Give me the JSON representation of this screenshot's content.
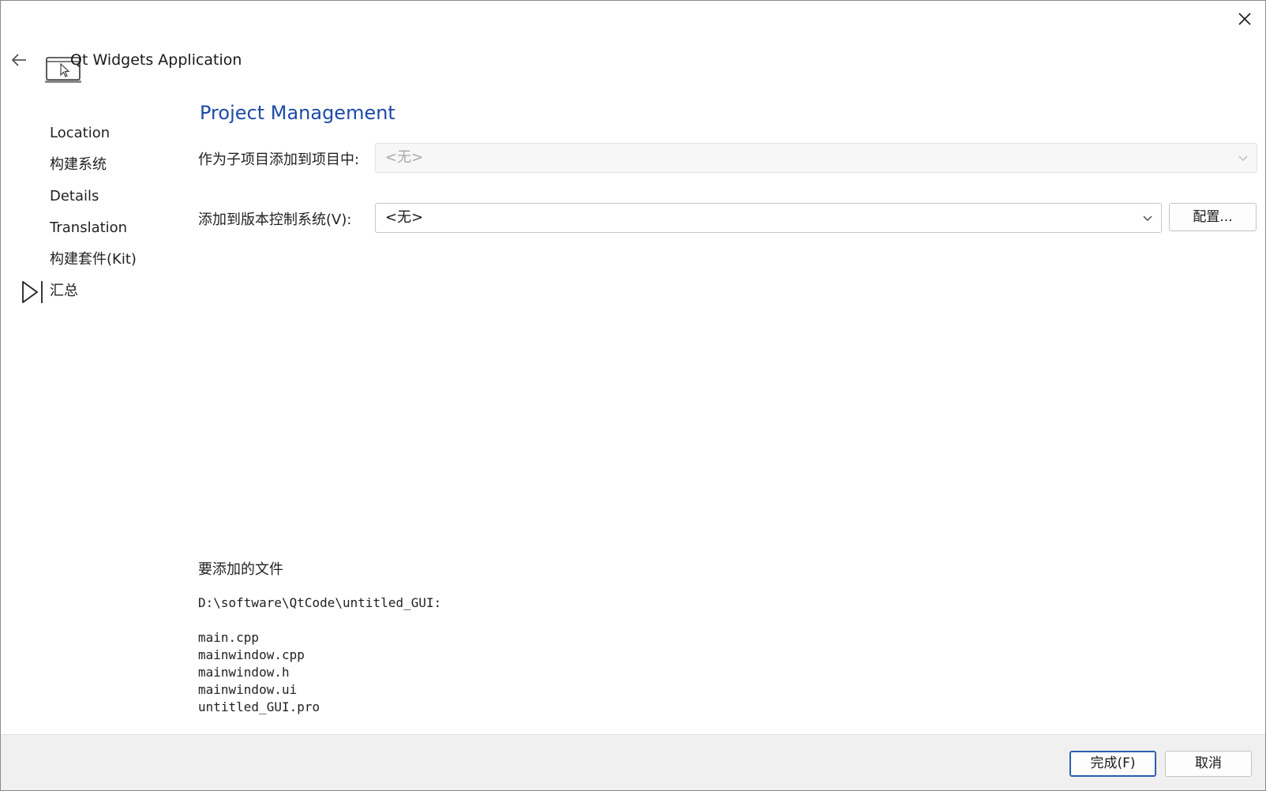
{
  "window": {
    "title": "Qt Widgets Application"
  },
  "steps": [
    {
      "label": "Location",
      "current": false
    },
    {
      "label": "构建系统",
      "current": false
    },
    {
      "label": "Details",
      "current": false
    },
    {
      "label": "Translation",
      "current": false
    },
    {
      "label": "构建套件(Kit)",
      "current": false
    },
    {
      "label": "汇总",
      "current": true
    }
  ],
  "page": {
    "title": "Project Management",
    "subproject_label": "作为子项目添加到项目中:",
    "subproject_value": "<无>",
    "vcs_label": "添加到版本控制系统(V):",
    "vcs_value": "<无>",
    "configure_label": "配置..."
  },
  "files": {
    "heading": "要添加的文件",
    "path": "D:\\software\\QtCode\\untitled_GUI:",
    "list": [
      "main.cpp",
      "mainwindow.cpp",
      "mainwindow.h",
      "mainwindow.ui",
      "untitled_GUI.pro"
    ]
  },
  "footer": {
    "finish_label": "完成(F)",
    "cancel_label": "取消"
  },
  "colors": {
    "title_blue": "#1d4aa8",
    "footer_bg": "#f0f0f0"
  }
}
